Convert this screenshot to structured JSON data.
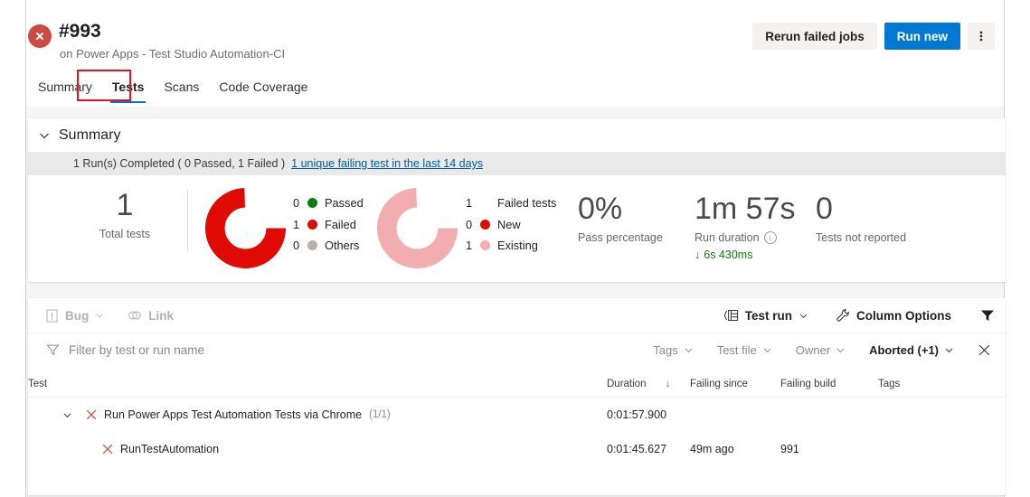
{
  "header": {
    "status_icon": "error-circle-icon",
    "title": "#993",
    "subtitle": "on Power Apps - Test Studio Automation-CI",
    "rerun_label": "Rerun failed jobs",
    "run_new_label": "Run new",
    "more_label": "⋮"
  },
  "tabs": [
    {
      "label": "Summary",
      "active": false
    },
    {
      "label": "Tests",
      "active": true
    },
    {
      "label": "Scans",
      "active": false
    },
    {
      "label": "Code Coverage",
      "active": false
    }
  ],
  "summary": {
    "section_label": "Summary",
    "strip_text": "1 Run(s) Completed ( 0 Passed, 1 Failed )",
    "strip_link": "1 unique failing test in the last 14 days",
    "total_tests": {
      "value": "1",
      "caption": "Total tests"
    },
    "outcome_donut": {
      "segments": [
        {
          "label": "Passed",
          "count": "0",
          "color": "#107c10",
          "fraction": 0
        },
        {
          "label": "Failed",
          "count": "1",
          "color": "#e00b00",
          "fraction": 1
        },
        {
          "label": "Others",
          "count": "0",
          "color": "#b3b0ad",
          "fraction": 0
        }
      ]
    },
    "failure_donut": {
      "header_count": "1",
      "header_label": "Failed tests",
      "segments": [
        {
          "label": "New",
          "count": "0",
          "color": "#e00b00",
          "fraction": 0
        },
        {
          "label": "Existing",
          "count": "1",
          "color": "#f2aeae",
          "fraction": 1
        }
      ]
    },
    "pass_percentage": {
      "value": "0%",
      "caption": "Pass percentage"
    },
    "run_duration": {
      "value": "1m 57s",
      "caption": "Run duration",
      "info_icon": "info-icon",
      "delta": "6s 430ms",
      "delta_direction": "↓",
      "delta_color": "#107c10"
    },
    "not_reported": {
      "value": "0",
      "caption": "Tests not reported"
    }
  },
  "results": {
    "toolbar": {
      "bug_label": "Bug",
      "bug_icon": "bug-report-icon",
      "link_label": "Link",
      "link_icon": "link-icon",
      "group_by_label": "Test run",
      "group_by_icon": "group-rows-icon",
      "column_options_label": "Column Options",
      "column_options_icon": "wrench-icon",
      "filter_icon": "filter-funnel-icon"
    },
    "filterbar": {
      "search_placeholder": "Filter by test or run name",
      "search_value": "",
      "search_icon": "filter-icon",
      "pills": [
        {
          "label": "Tags",
          "active": false
        },
        {
          "label": "Test file",
          "active": false
        },
        {
          "label": "Owner",
          "active": false
        },
        {
          "label": "Aborted (+1)",
          "active": true
        }
      ],
      "clear_icon": "close-icon"
    },
    "columns": [
      {
        "key": "test",
        "label": "Test"
      },
      {
        "key": "duration",
        "label": "Duration",
        "sort": "↓"
      },
      {
        "key": "failing_since",
        "label": "Failing since"
      },
      {
        "key": "failing_build",
        "label": "Failing build"
      },
      {
        "key": "tags",
        "label": "Tags"
      }
    ],
    "rows": [
      {
        "type": "group",
        "expanded": true,
        "status_icon": "x-error-icon",
        "name": "Run Power Apps Test Automation Tests via Chrome",
        "count": "(1/1)",
        "duration": "0:01:57.900",
        "failing_since": "",
        "failing_build": "",
        "tags": ""
      },
      {
        "type": "child",
        "status_icon": "x-error-icon",
        "name": "RunTestAutomation",
        "count": "",
        "duration": "0:01:45.627",
        "failing_since": "49m ago",
        "failing_build": "991",
        "tags": ""
      }
    ]
  },
  "annotation": {
    "shape": "red-rectangle",
    "target": "Tests tab",
    "color": "#e81123"
  }
}
